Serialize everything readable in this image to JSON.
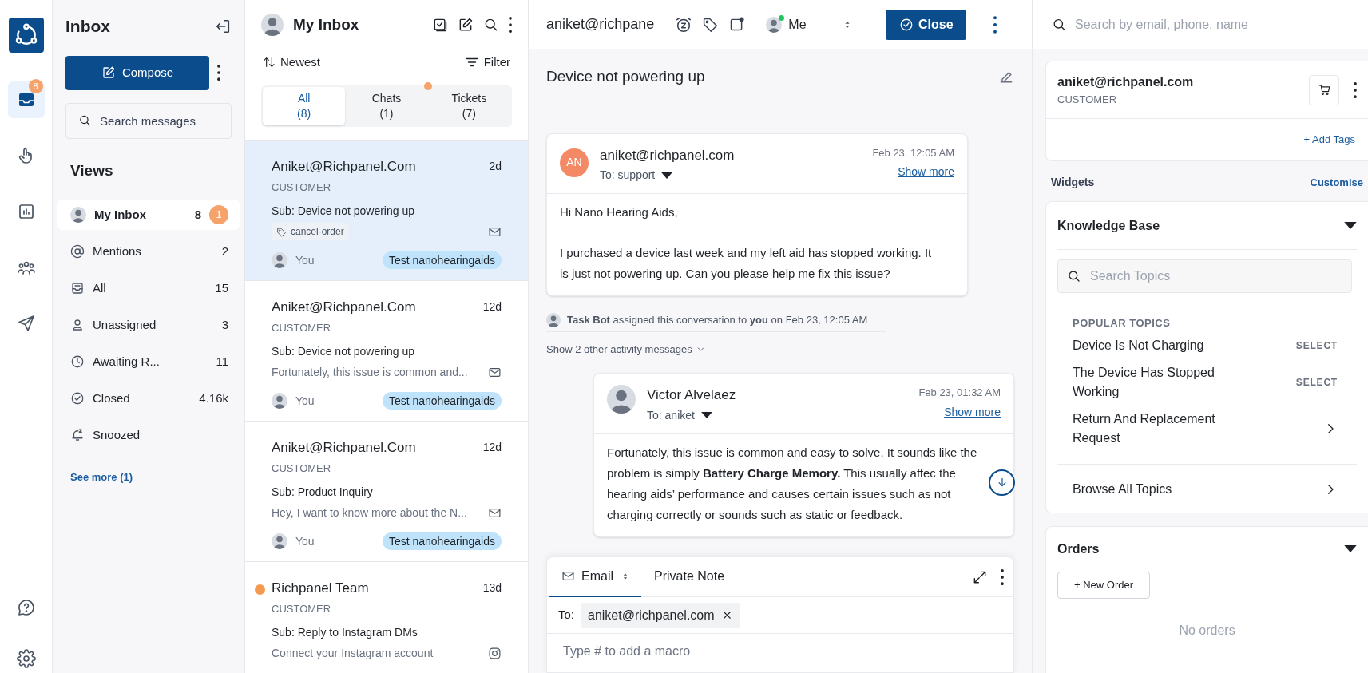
{
  "rail": {
    "items": [
      {
        "kind": "inbox",
        "badge": "8",
        "selected": true
      },
      {
        "kind": "hand",
        "selected": false
      },
      {
        "kind": "chart",
        "selected": false
      },
      {
        "kind": "team",
        "selected": false
      },
      {
        "kind": "send",
        "selected": false
      }
    ],
    "bottom": [
      {
        "kind": "help"
      },
      {
        "kind": "settings"
      }
    ]
  },
  "nav": {
    "title": "Inbox",
    "compose": "Compose",
    "search": {
      "placeholder": "Search messages"
    },
    "views_title": "Views",
    "views": [
      {
        "kind": "avatar",
        "label": "My Inbox",
        "count": "8",
        "badge": "1",
        "selected": true
      },
      {
        "kind": "at",
        "label": "Mentions",
        "count": "2",
        "selected": false
      },
      {
        "kind": "tray",
        "label": "All",
        "count": "15",
        "selected": false
      },
      {
        "kind": "person",
        "label": "Unassigned",
        "count": "3",
        "selected": false
      },
      {
        "kind": "clock",
        "label": "Awaiting R...",
        "count": "11",
        "selected": false
      },
      {
        "kind": "check",
        "label": "Closed",
        "count": "4.16k",
        "selected": false
      },
      {
        "kind": "snooze",
        "label": "Snoozed",
        "selected": false
      }
    ],
    "see_more": "See more (1)"
  },
  "inbox": {
    "title": "My Inbox",
    "sort": "Newest",
    "filter": "Filter",
    "tabs": [
      {
        "label": "All",
        "count": "(8)",
        "selected": true,
        "dot": false
      },
      {
        "label": "Chats",
        "count": "(1)",
        "selected": false,
        "dot": true
      },
      {
        "label": "Tickets",
        "count": "(7)",
        "selected": false,
        "dot": false
      }
    ],
    "conversations": [
      {
        "name": "Aniket@Richpanel.Com",
        "age": "2d",
        "role": "CUSTOMER",
        "subject": "Sub: Device not powering up",
        "tag": "cancel-order",
        "kind": "email",
        "assignee": "You",
        "team": "Test nanohearingaids",
        "unread": false,
        "selected": true
      },
      {
        "name": "Aniket@Richpanel.Com",
        "age": "12d",
        "role": "CUSTOMER",
        "subject": "Sub: Device not powering up",
        "preview": "Fortunately, this issue is common and...",
        "kind": "email",
        "assignee": "You",
        "team": "Test nanohearingaids",
        "unread": false,
        "selected": false
      },
      {
        "name": "Aniket@Richpanel.Com",
        "age": "12d",
        "role": "CUSTOMER",
        "subject": "Sub: Product Inquiry",
        "preview": "Hey, I want to know more about the N...",
        "kind": "email",
        "assignee": "You",
        "team": "Test nanohearingaids",
        "unread": false,
        "selected": false
      },
      {
        "name": "Richpanel Team",
        "age": "13d",
        "role": "CUSTOMER",
        "subject": "Sub: Reply to Instagram DMs",
        "preview": "Connect your Instagram account",
        "kind": "instagram",
        "unread": true,
        "selected": false
      }
    ]
  },
  "conversation": {
    "header_email": "aniket@richpane",
    "assignee": "Me",
    "close": "Close",
    "subject": "Device not powering up",
    "messages": [
      {
        "kind": "initials",
        "initials": "AN",
        "sender": "aniket@richpanel.com",
        "to": "To: support",
        "time": "Feb 23, 12:05 AM",
        "show_more": "Show more",
        "body": [
          "Hi Nano Hearing Aids,",
          "I purchased a device last week and my left aid has stopped working. It is just not powering up. Can you please help me fix this issue?"
        ]
      },
      {
        "kind": "photo",
        "sender": "Victor Alvelaez",
        "to": "To: aniket",
        "time": "Feb 23, 01:32 AM",
        "show_more": "Show more",
        "body": [
          "Fortunately, this issue is common and easy to solve. It sounds like the problem is simply **Battery Charge Memory.** This usually affec the hearing aids’ performance and causes certain issues such as not charging correctly or sounds such as static or feedback."
        ]
      }
    ],
    "activity": "**Task Bot** assigned this conversation to **you** on Feb 23, 12:05 AM",
    "show_activity": "Show 2 other activity messages",
    "composer": {
      "tabs": [
        {
          "label": "Email",
          "selected": true
        },
        {
          "label": "Private Note",
          "selected": false
        }
      ],
      "to_label": "To:",
      "recipient": "aniket@richpanel.com",
      "placeholder": "Type # to add a macro"
    }
  },
  "customer": {
    "search": {
      "placeholder": "Search by email, phone, name"
    },
    "email": "aniket@richpanel.com",
    "role": "CUSTOMER",
    "add_tags": "+ Add Tags",
    "widgets_title": "Widgets",
    "customise": "Customise",
    "knowledge_base": {
      "title": "Knowledge Base",
      "expanded": true,
      "search": {
        "placeholder": "Search Topics"
      },
      "section": "POPULAR TOPICS",
      "topics": [
        {
          "label": "Device Is Not Charging",
          "kind": "select",
          "action": "SELECT"
        },
        {
          "label": "The Device Has Stopped Working",
          "kind": "select",
          "action": "SELECT"
        },
        {
          "label": "Return And Replacement Request",
          "kind": "link"
        }
      ],
      "browse": "Browse All Topics"
    },
    "orders": {
      "title": "Orders",
      "expanded": true,
      "new_order": "+ New Order",
      "empty": "No orders"
    }
  }
}
